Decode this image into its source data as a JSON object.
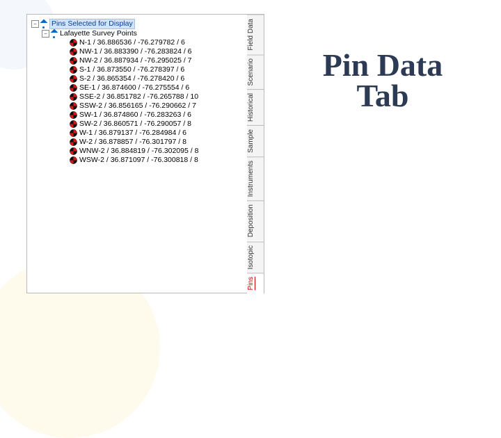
{
  "title_line1": "Pin Data",
  "title_line2": "Tab",
  "tabs": [
    {
      "id": "field-data",
      "label": "Field Data",
      "active": false
    },
    {
      "id": "scenario",
      "label": "Scenario",
      "active": false
    },
    {
      "id": "historical",
      "label": "Historical",
      "active": false
    },
    {
      "id": "sample",
      "label": "Sample",
      "active": false
    },
    {
      "id": "instruments",
      "label": "Instruments",
      "active": false
    },
    {
      "id": "deposition",
      "label": "Deposition",
      "active": false
    },
    {
      "id": "isotopic",
      "label": "Isotopic",
      "active": false
    },
    {
      "id": "pins",
      "label": "Pins",
      "active": true
    }
  ],
  "tree": {
    "root": {
      "label": "Pins Selected for Display",
      "toggle": "−"
    },
    "group": {
      "label": "Lafayette Survey Points",
      "toggle": "−"
    },
    "pins": [
      {
        "label": "N-1 / 36.886536 / -76.279782 / 6"
      },
      {
        "label": "NW-1 / 36.883390 / -76.283824 / 6"
      },
      {
        "label": "NW-2 / 36.887934 / -76.295025 / 7"
      },
      {
        "label": "S-1 / 36.873550 / -76.278397 / 6"
      },
      {
        "label": "S-2 / 36.865354 / -76.278420 / 6"
      },
      {
        "label": "SE-1 / 36.874600 / -76.275554 / 6"
      },
      {
        "label": "SSE-2 / 36.851782 / -76.265788 / 10"
      },
      {
        "label": "SSW-2 / 36.856165 / -76.290662 / 7"
      },
      {
        "label": "SW-1 / 36.874860 / -76.283263 / 6"
      },
      {
        "label": "SW-2 / 36.860571 / -76.290057 / 8"
      },
      {
        "label": "W-1 / 36.879137 / -76.284984 / 6"
      },
      {
        "label": "W-2 / 36.878857 / -76.301797 / 8"
      },
      {
        "label": "WNW-2 / 36.884819 / -76.302095 / 8"
      },
      {
        "label": "WSW-2 / 36.871097 / -76.300818 / 8"
      }
    ]
  }
}
